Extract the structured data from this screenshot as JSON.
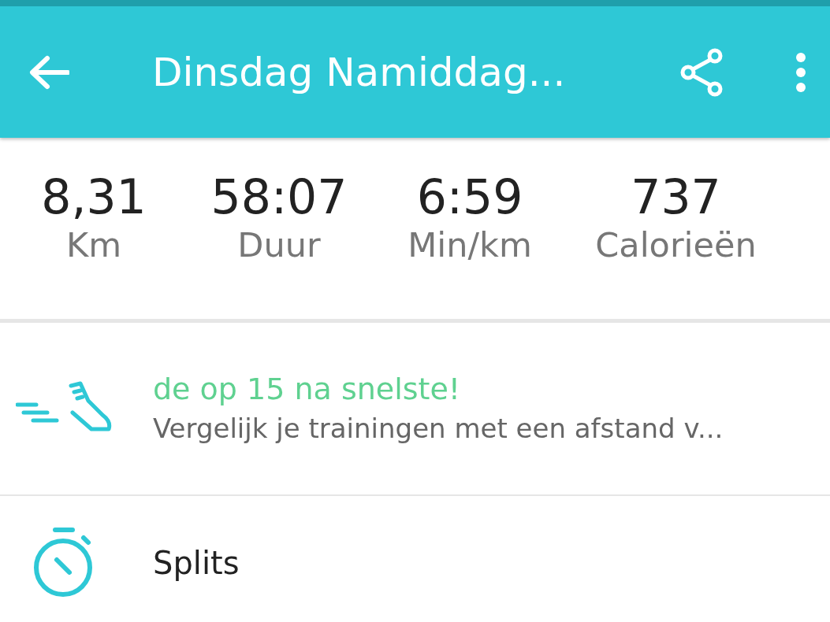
{
  "header": {
    "title": "Dinsdag Namiddag..."
  },
  "stats": [
    {
      "value": "8,31",
      "label": "Km"
    },
    {
      "value": "58:07",
      "label": "Duur"
    },
    {
      "value": "6:59",
      "label": "Min/km"
    },
    {
      "value": "737",
      "label": "Calorieën"
    }
  ],
  "rows": [
    {
      "kind": "achievement",
      "title": "de op 15 na snelste!",
      "subtitle": "Vergelijk je trainingen met een afstand v..."
    },
    {
      "kind": "splits",
      "title": "Splits"
    }
  ]
}
